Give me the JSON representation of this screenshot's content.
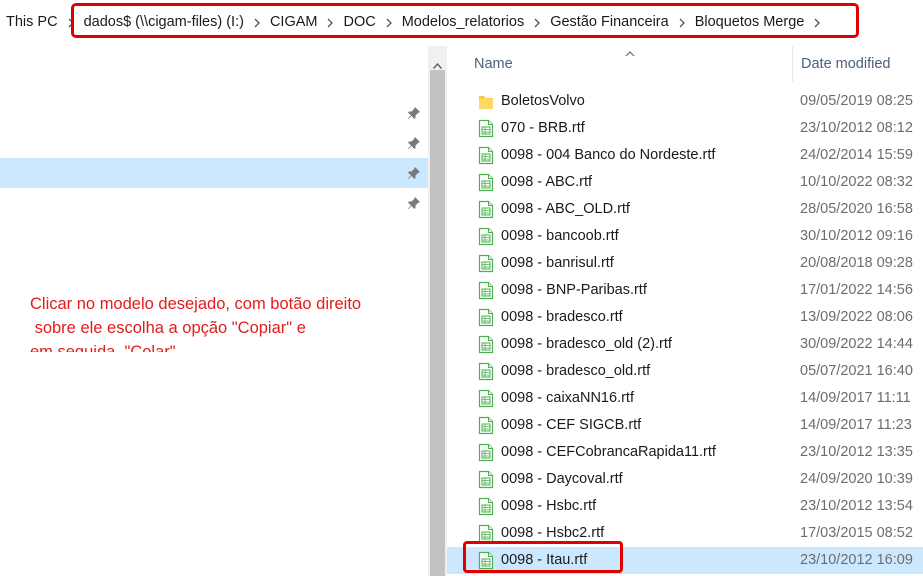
{
  "breadcrumb": {
    "items": [
      "This PC",
      "dados$ (\\\\cigam-files) (I:)",
      "CIGAM",
      "DOC",
      "Modelos_relatorios",
      "Gestão Financeira",
      "Bloquetos Merge"
    ]
  },
  "annotation": {
    "text": "Clicar no modelo desejado, com botão direito\n sobre ele escolha a opção \"Copiar\" e\nem seguida, \"Colar\""
  },
  "columns": {
    "name": "Name",
    "date_modified": "Date modified"
  },
  "files": [
    {
      "name": "BoletosVolvo",
      "date": "09/05/2019 08:25",
      "icon": "folder-icon"
    },
    {
      "name": "070 - BRB.rtf",
      "date": "23/10/2012 08:12",
      "icon": "rtf-file-icon"
    },
    {
      "name": "0098 - 004 Banco do Nordeste.rtf",
      "date": "24/02/2014 15:59",
      "icon": "rtf-file-icon"
    },
    {
      "name": "0098 - ABC.rtf",
      "date": "10/10/2022 08:32",
      "icon": "rtf-file-icon"
    },
    {
      "name": "0098 - ABC_OLD.rtf",
      "date": "28/05/2020 16:58",
      "icon": "rtf-file-icon"
    },
    {
      "name": "0098 - bancoob.rtf",
      "date": "30/10/2012 09:16",
      "icon": "rtf-file-icon"
    },
    {
      "name": "0098 - banrisul.rtf",
      "date": "20/08/2018 09:28",
      "icon": "rtf-file-icon"
    },
    {
      "name": "0098 - BNP-Paribas.rtf",
      "date": "17/01/2022 14:56",
      "icon": "rtf-file-icon"
    },
    {
      "name": "0098 - bradesco.rtf",
      "date": "13/09/2022 08:06",
      "icon": "rtf-file-icon"
    },
    {
      "name": "0098 - bradesco_old (2).rtf",
      "date": "30/09/2022 14:44",
      "icon": "rtf-file-icon"
    },
    {
      "name": "0098 - bradesco_old.rtf",
      "date": "05/07/2021 16:40",
      "icon": "rtf-file-icon"
    },
    {
      "name": "0098 - caixaNN16.rtf",
      "date": "14/09/2017 11:11",
      "icon": "rtf-file-icon"
    },
    {
      "name": "0098 - CEF SIGCB.rtf",
      "date": "14/09/2017 11:23",
      "icon": "rtf-file-icon"
    },
    {
      "name": "0098 - CEFCobrancaRapida11.rtf",
      "date": "23/10/2012 13:35",
      "icon": "rtf-file-icon"
    },
    {
      "name": "0098 - Daycoval.rtf",
      "date": "24/09/2020 10:39",
      "icon": "rtf-file-icon"
    },
    {
      "name": "0098 - Hsbc.rtf",
      "date": "23/10/2012 13:54",
      "icon": "rtf-file-icon"
    },
    {
      "name": "0098 - Hsbc2.rtf",
      "date": "17/03/2015 08:52",
      "icon": "rtf-file-icon"
    },
    {
      "name": "0098 - Itau.rtf",
      "date": "23/10/2012 16:09",
      "icon": "rtf-file-icon",
      "selected": true
    }
  ],
  "colors": {
    "selection": "#cce8ff",
    "highlight_border": "#e00000",
    "annotation_text": "#e41b1b",
    "header_text": "#4c607a"
  }
}
